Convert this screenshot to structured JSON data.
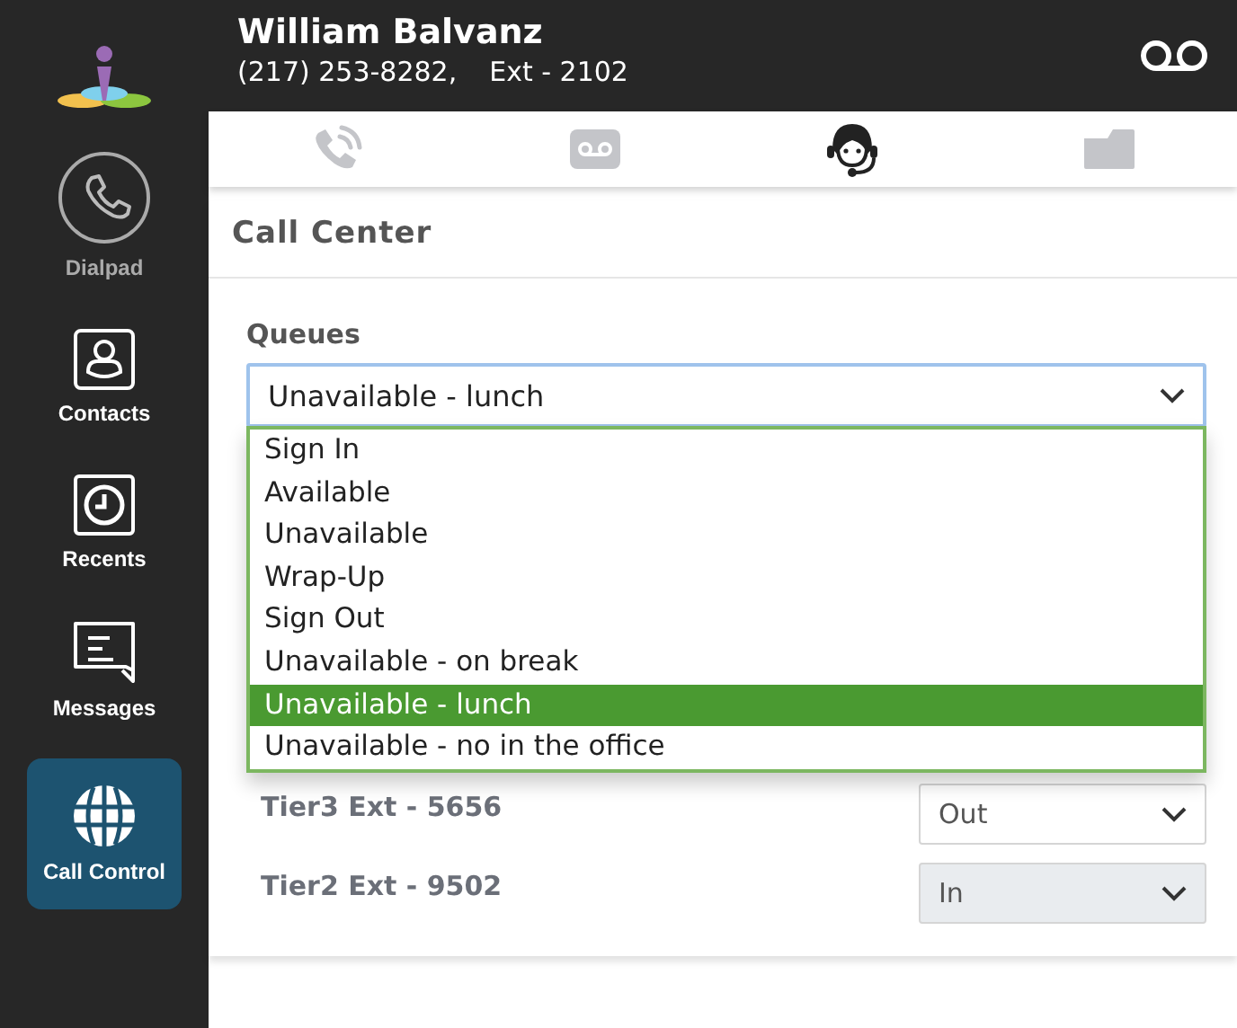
{
  "user": {
    "name": "William Balvanz",
    "phone": "(217) 253-8282,",
    "ext": "Ext - 2102"
  },
  "sidebar": {
    "items": [
      {
        "label": "Dialpad",
        "kind": "dialpad",
        "selected": false
      },
      {
        "label": "Contacts",
        "kind": "contacts",
        "selected": false
      },
      {
        "label": "Recents",
        "kind": "recents",
        "selected": false
      },
      {
        "label": "Messages",
        "kind": "messages",
        "selected": false
      },
      {
        "label": "Call Control",
        "kind": "globe",
        "selected": true
      }
    ]
  },
  "tabs": [
    {
      "kind": "calls",
      "selected": false
    },
    {
      "kind": "voicemail",
      "selected": false
    },
    {
      "kind": "agent",
      "selected": true
    },
    {
      "kind": "folder",
      "selected": false
    }
  ],
  "panel": {
    "title": "Call Center",
    "queues_label": "Queues",
    "queue_select": {
      "value": "Unavailable - lunch",
      "expanded": true
    },
    "options": [
      {
        "label": "Sign In",
        "selected": false
      },
      {
        "label": "Available",
        "selected": false
      },
      {
        "label": "Unavailable",
        "selected": false
      },
      {
        "label": "Wrap-Up",
        "selected": false
      },
      {
        "label": "Sign Out",
        "selected": false
      },
      {
        "label": "Unavailable - on break",
        "selected": false
      },
      {
        "label": "Unavailable - lunch",
        "selected": true
      },
      {
        "label": "Unavailable - no in the office",
        "selected": false
      }
    ],
    "queues": [
      {
        "name": "Tier3 Ext - 5656",
        "value": "Out",
        "disabled": false
      },
      {
        "name": "Tier2 Ext - 9502",
        "value": "In",
        "disabled": true
      }
    ]
  }
}
